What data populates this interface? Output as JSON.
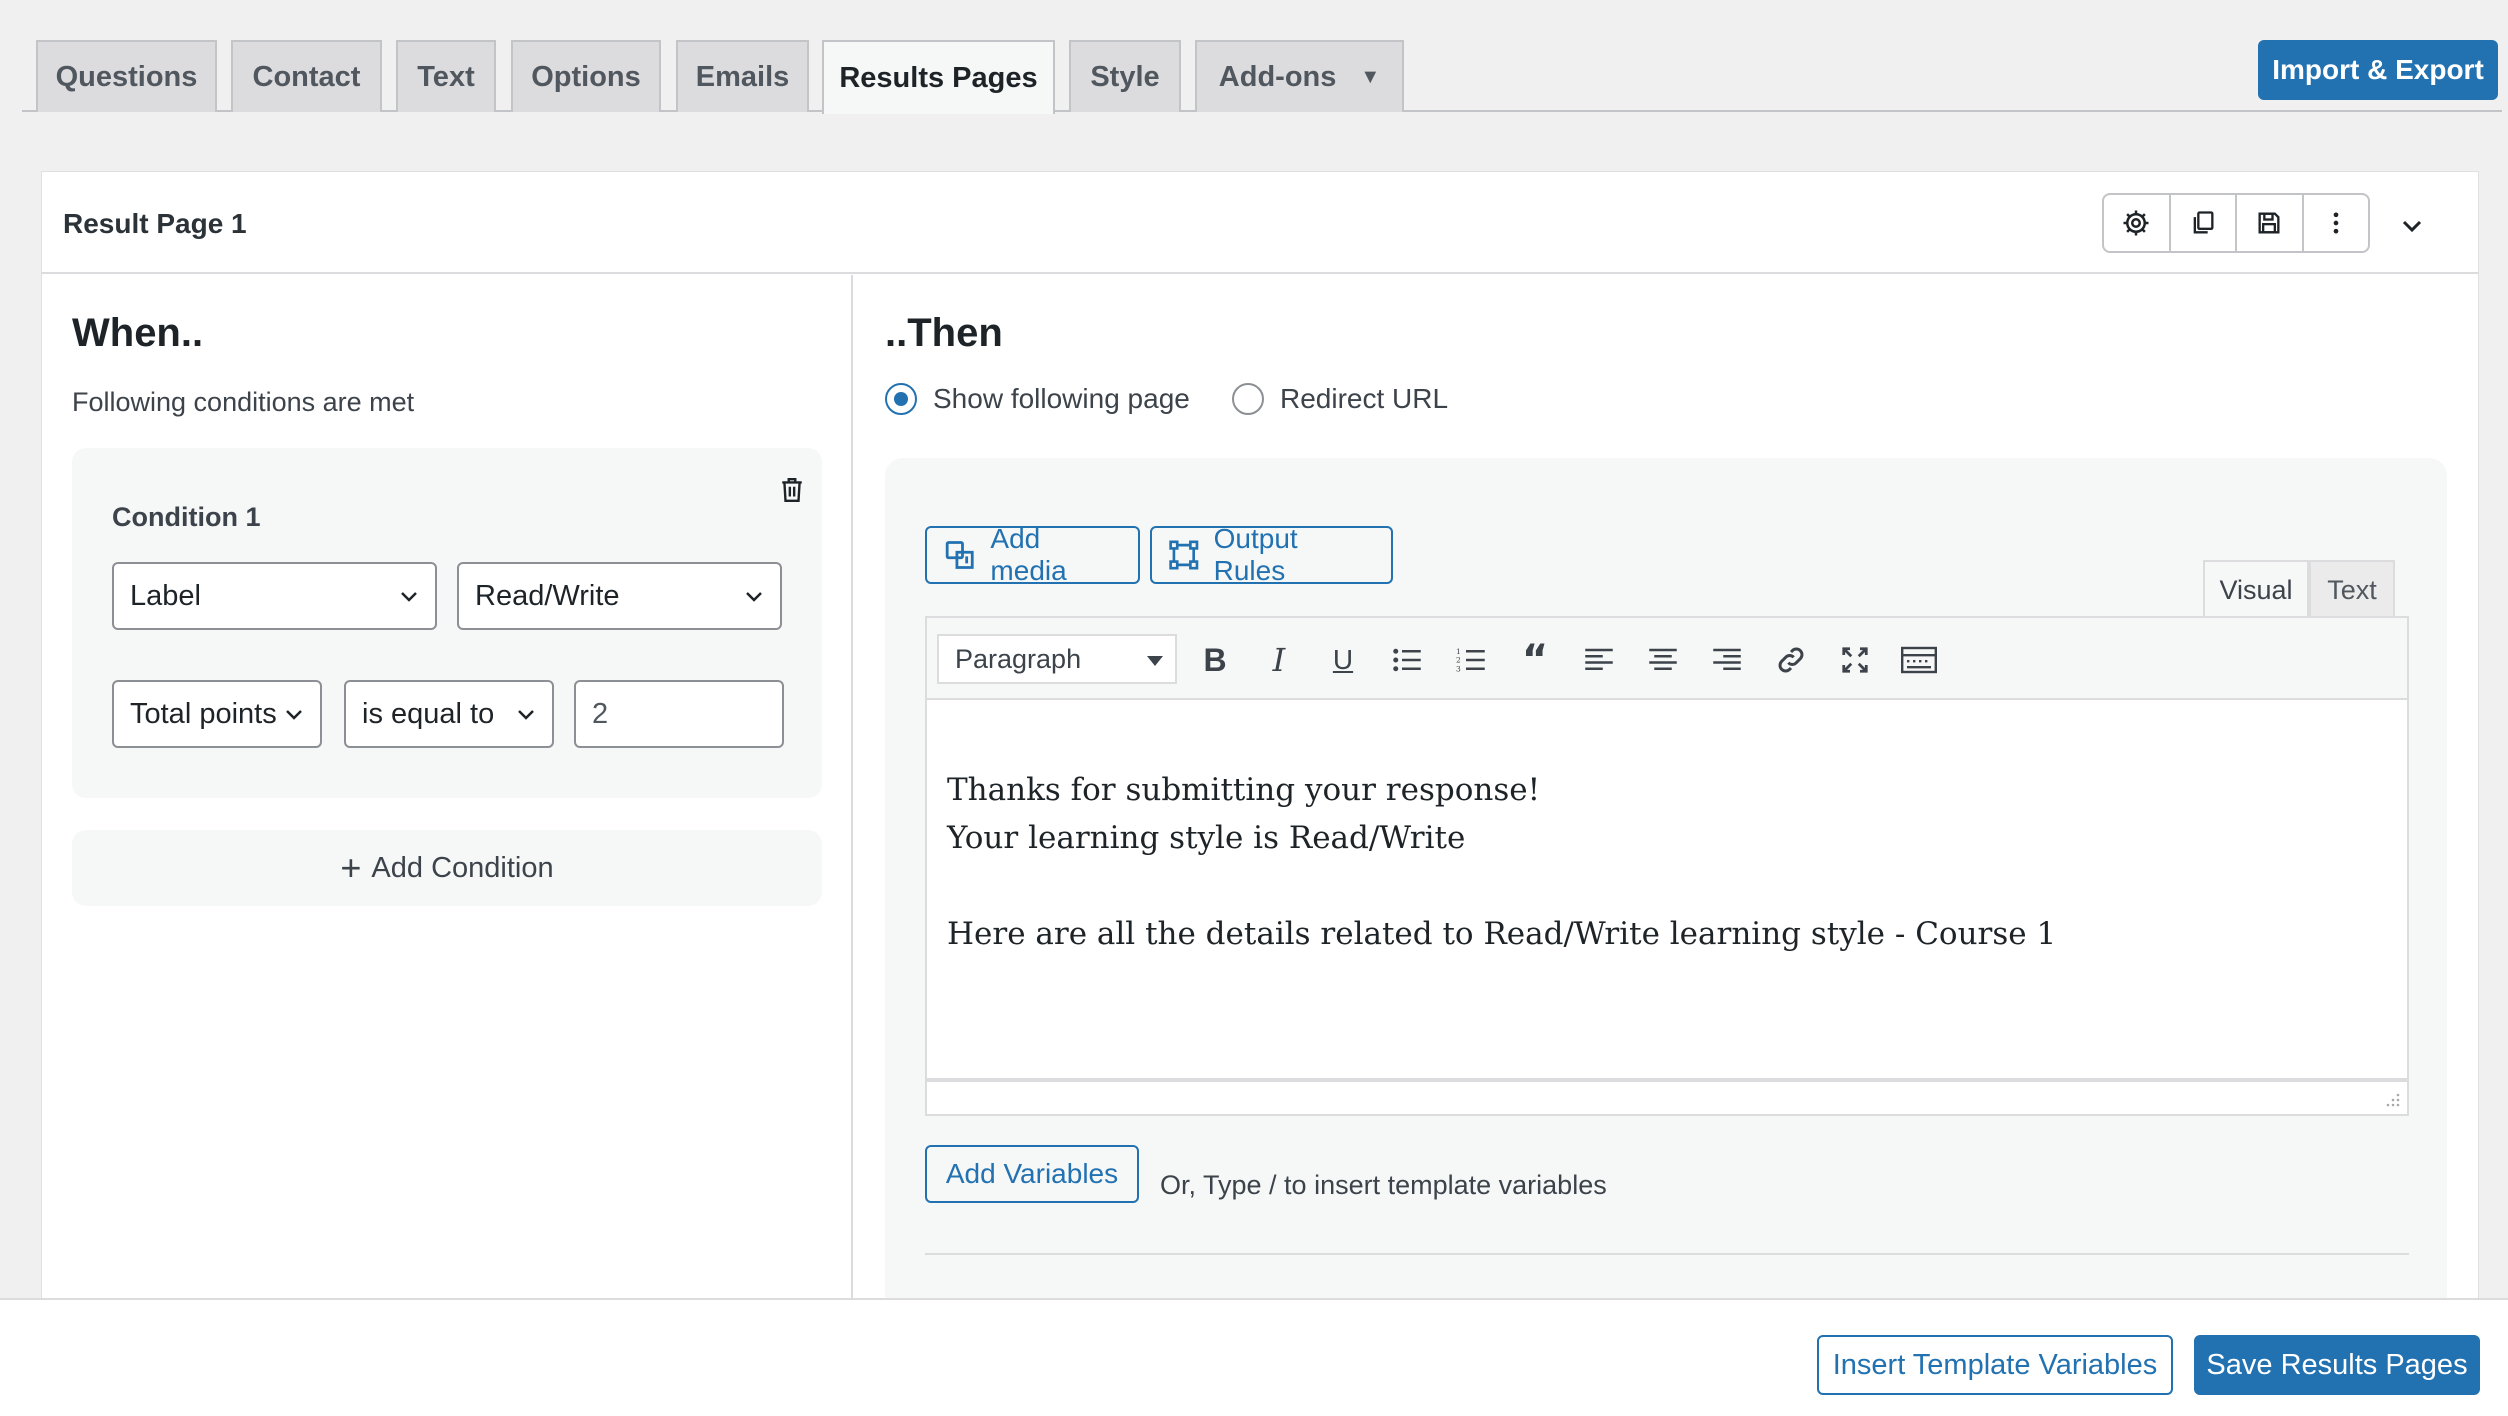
{
  "tabs": [
    {
      "label": "Questions"
    },
    {
      "label": "Contact"
    },
    {
      "label": "Text"
    },
    {
      "label": "Options"
    },
    {
      "label": "Emails"
    },
    {
      "label": "Results Pages",
      "active": true
    },
    {
      "label": "Style"
    },
    {
      "label": "Add-ons",
      "has_dropdown": true
    }
  ],
  "import_export_label": "Import & Export",
  "result_page": {
    "title": "Result Page 1",
    "header_icons": [
      "gear-icon",
      "duplicate-icon",
      "save-icon",
      "more-vertical-icon"
    ],
    "collapse_icon": "chevron-down-icon"
  },
  "when": {
    "heading": "When..",
    "subheading": "Following conditions are met",
    "condition": {
      "label": "Condition 1",
      "field_1": "Label",
      "field_2": "Read/Write",
      "field_3": "Total points",
      "operator": "is equal to",
      "value": "2"
    },
    "add_condition_label": "Add Condition"
  },
  "then": {
    "heading": "..Then",
    "options": [
      {
        "label": "Show following page",
        "selected": true
      },
      {
        "label": "Redirect URL",
        "selected": false
      }
    ],
    "add_media_label": "Add media",
    "output_rules_label": "Output Rules",
    "editor_tabs": {
      "visual": "Visual",
      "text": "Text",
      "active": "Visual"
    },
    "format_select": "Paragraph",
    "toolbar_icons": [
      "bold-icon",
      "italic-icon",
      "underline-icon",
      "bullet-list-icon",
      "numbered-list-icon",
      "blockquote-icon",
      "align-left-icon",
      "align-center-icon",
      "align-right-icon",
      "link-icon",
      "fullscreen-icon",
      "toolbar-toggle-icon"
    ],
    "content_lines": [
      "Thanks for submitting your response!",
      "Your learning style is Read/Write",
      "",
      "Here are all the details related to Read/Write learning style - Course 1"
    ],
    "add_variables_label": "Add Variables",
    "variables_hint": "Or, Type / to insert template variables"
  },
  "footer": {
    "insert_template_label": "Insert Template Variables",
    "save_label": "Save Results Pages"
  },
  "colors": {
    "primary": "#2271b1",
    "background": "#f0f0f1"
  }
}
